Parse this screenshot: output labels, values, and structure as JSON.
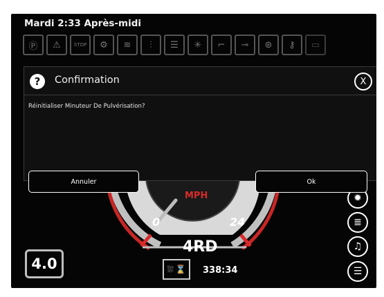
{
  "status": {
    "datetime": "Mardi 2:33 Après-midi"
  },
  "telltales": [
    "P",
    "!",
    "STOP",
    "pto",
    "wave",
    "lamp",
    "beam",
    "fan",
    "seat",
    "oil",
    "gear",
    "key",
    "box"
  ],
  "dialog": {
    "title": "Confirmation",
    "message": "Réinitialiser Minuteur De Pulvérisation?",
    "cancel_label": "Annuler",
    "ok_label": "Ok",
    "close_glyph": "X",
    "question_glyph": "?"
  },
  "gauge": {
    "unit": "MPH",
    "tick_min": "0",
    "tick_max": "24",
    "gear": "4RD"
  },
  "speed_setting": "4.0",
  "spray_timer": "338:34",
  "colors": {
    "accent_red": "#d92a2a",
    "background": "#050505"
  }
}
